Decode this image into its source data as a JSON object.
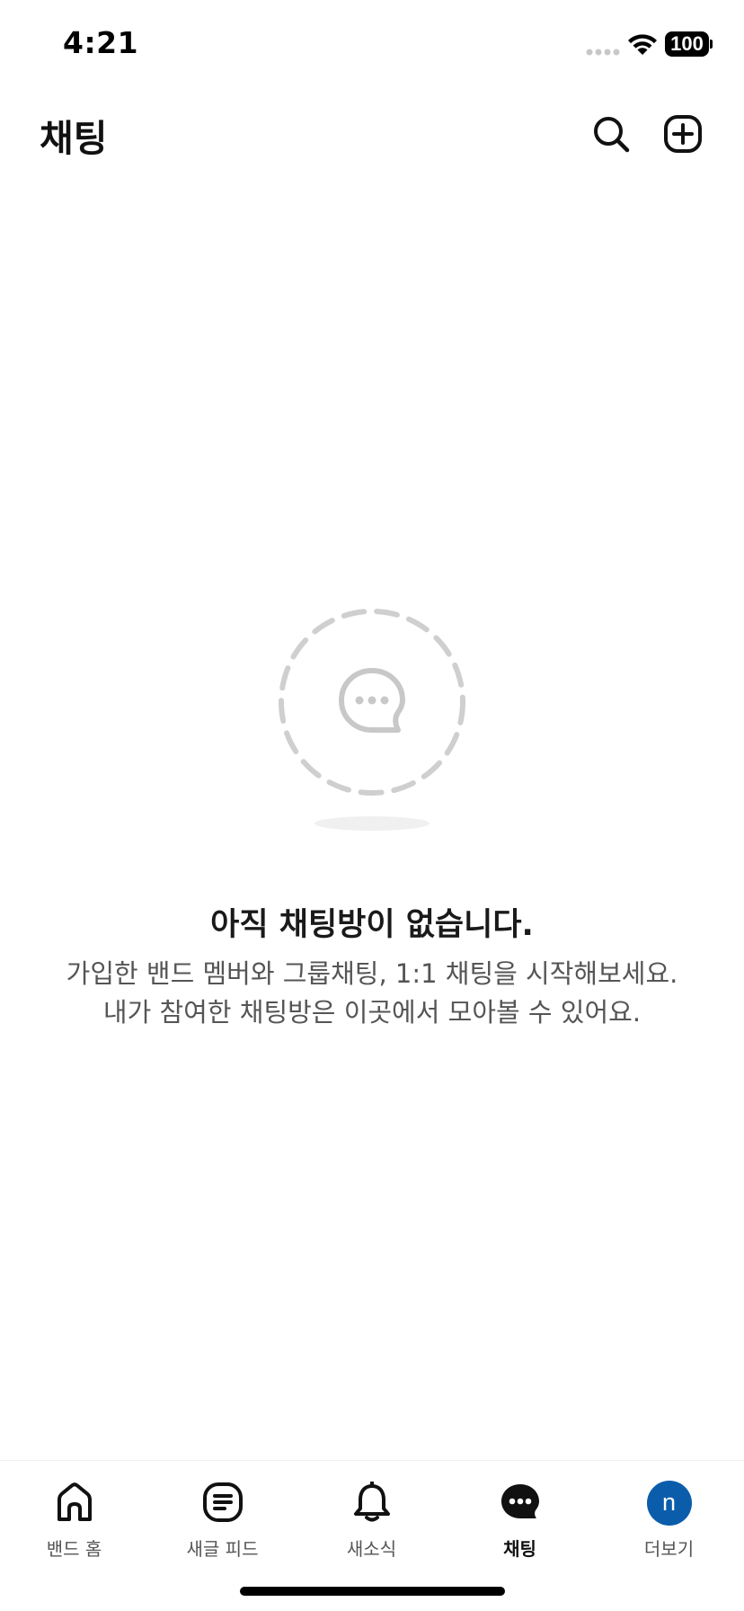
{
  "status_bar": {
    "time": "4:21",
    "battery": "100"
  },
  "header": {
    "title": "채팅",
    "search_icon": "search-icon",
    "add_icon": "plus-square-icon"
  },
  "empty_state": {
    "icon": "chat-bubble-icon",
    "title": "아직 채팅방이 없습니다.",
    "description_lines": [
      "가입한 밴드 멤버와 그룹채팅, 1:1 채팅을 시작해보세요.",
      "내가 참여한 채팅방은 이곳에서 모아볼 수 있어요."
    ]
  },
  "bottom_nav": {
    "active": "채팅",
    "items": [
      {
        "label": "밴드 홈",
        "icon": "home-icon"
      },
      {
        "label": "새글 피드",
        "icon": "feed-icon"
      },
      {
        "label": "새소식",
        "icon": "bell-icon"
      },
      {
        "label": "채팅",
        "icon": "chat-icon"
      },
      {
        "label": "더보기",
        "icon": "avatar",
        "avatar_letter": "n"
      }
    ]
  },
  "colors": {
    "avatar_bg": "#0b5dab",
    "text_primary": "#111111",
    "text_secondary": "#555555",
    "illustration_gray": "#cccccc"
  }
}
